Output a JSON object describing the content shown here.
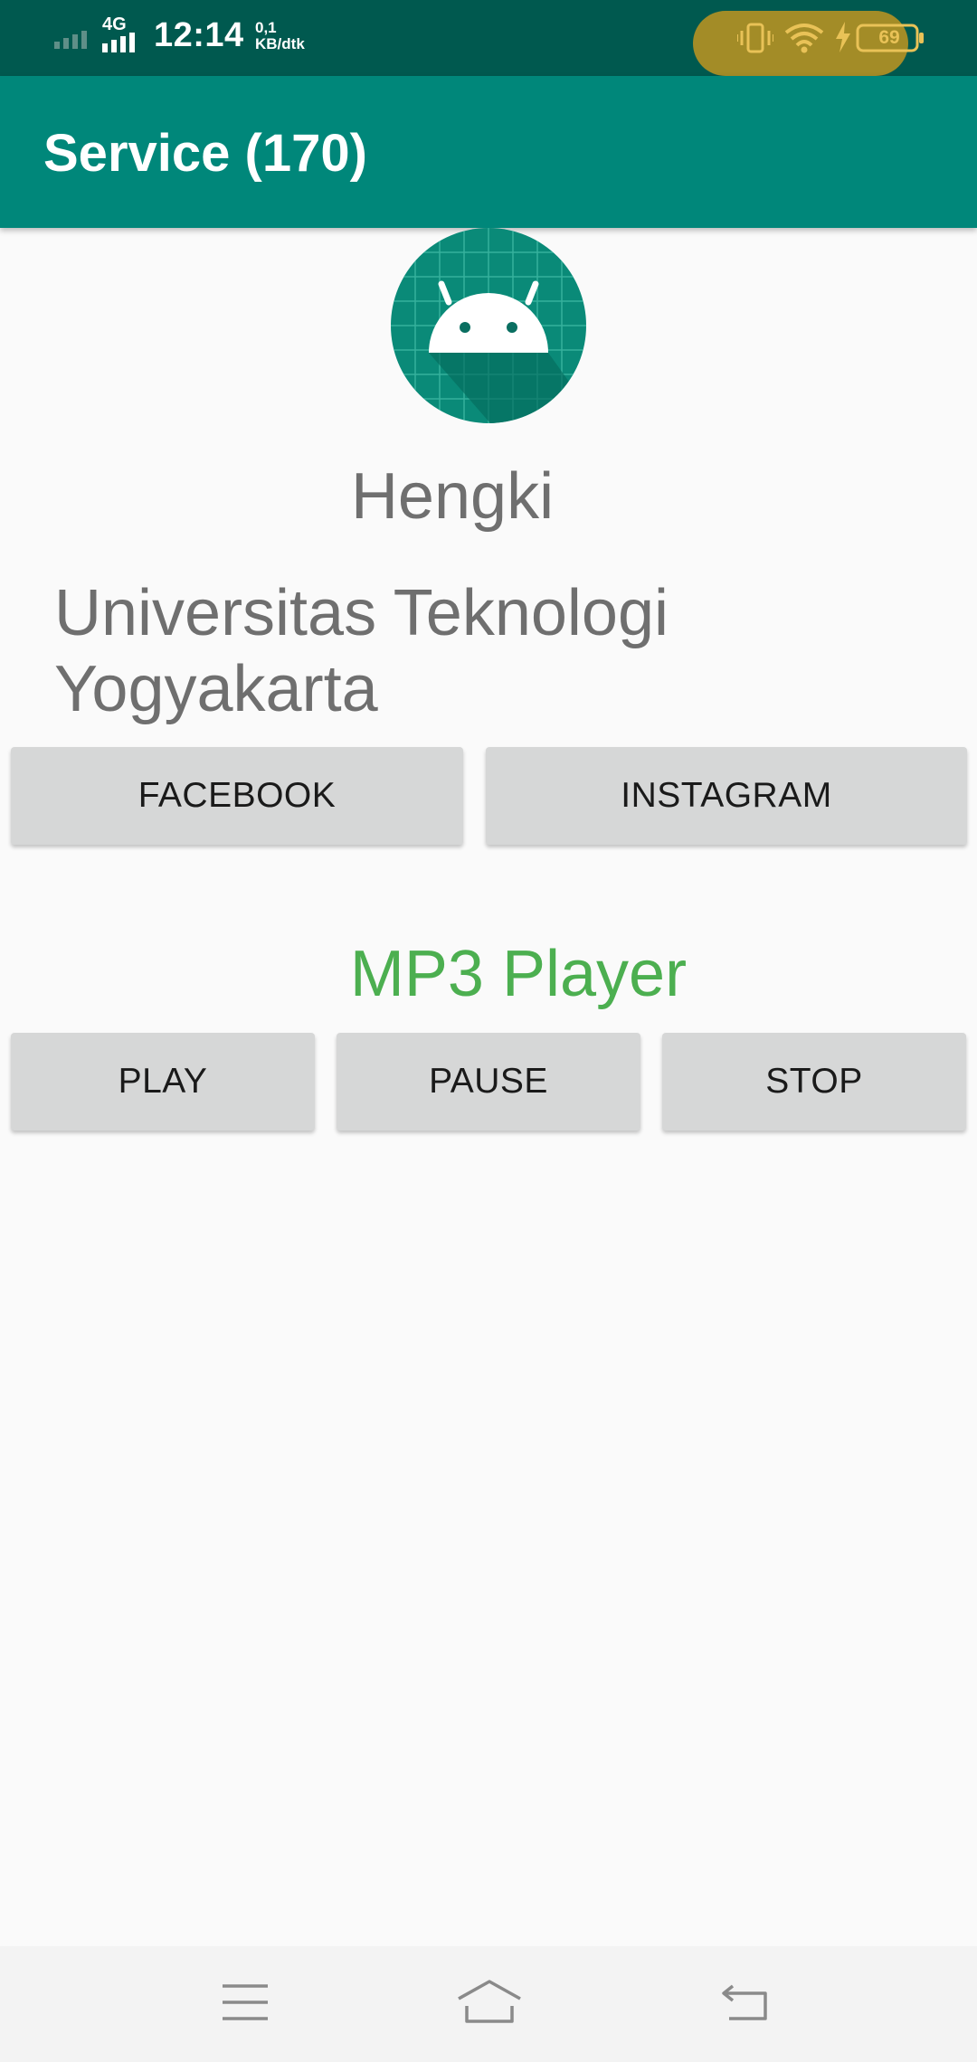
{
  "status_bar": {
    "network": "4G",
    "time": "12:14",
    "speed_value": "0,1",
    "speed_unit": "KB/dtk",
    "battery": "69",
    "icons": [
      "signal-icon",
      "vibrate-icon",
      "wifi-icon",
      "charging-icon",
      "battery-icon"
    ]
  },
  "app_bar": {
    "title": "Service (170)"
  },
  "profile": {
    "avatar_icon": "android-robot-icon",
    "name": "Hengki",
    "school": "Universitas Teknologi Yogyakarta"
  },
  "social_buttons": {
    "facebook": "FACEBOOK",
    "instagram": "INSTAGRAM"
  },
  "player": {
    "title": "MP3 Player",
    "play": "PLAY",
    "pause": "PAUSE",
    "stop": "STOP"
  },
  "nav_bar": {
    "icons": [
      "menu-icon",
      "home-icon",
      "back-icon"
    ]
  },
  "colors": {
    "status_bar": "#00594f",
    "app_bar": "#00877a",
    "accent_green": "#4caf50",
    "button_bg": "#d6d7d7",
    "text_gray": "#6f6f6f",
    "battery_pill": "#a38c27"
  }
}
